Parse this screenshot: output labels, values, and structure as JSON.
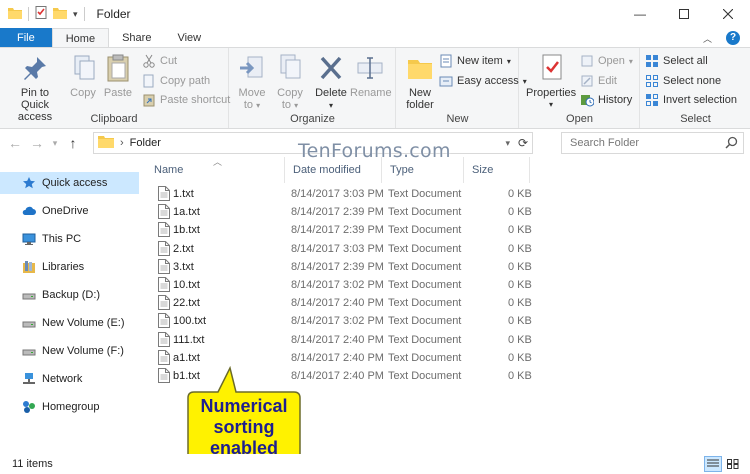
{
  "window": {
    "title": "Folder"
  },
  "tabs": [
    {
      "label": "File"
    },
    {
      "label": "Home"
    },
    {
      "label": "Share"
    },
    {
      "label": "View"
    }
  ],
  "ribbon": {
    "clipboard": {
      "label": "Clipboard",
      "pin": "Pin to Quick access",
      "copy": "Copy",
      "paste": "Paste",
      "cut": "Cut",
      "copy_path": "Copy path",
      "paste_shortcut": "Paste shortcut"
    },
    "organize": {
      "label": "Organize",
      "move_to": "Move to",
      "copy_to": "Copy to",
      "delete": "Delete",
      "rename": "Rename"
    },
    "new": {
      "label": "New",
      "new_folder": "New folder",
      "new_item": "New item",
      "easy_access": "Easy access"
    },
    "open": {
      "label": "Open",
      "properties": "Properties",
      "open": "Open",
      "edit": "Edit",
      "history": "History"
    },
    "select": {
      "label": "Select",
      "select_all": "Select all",
      "select_none": "Select none",
      "invert": "Invert selection"
    }
  },
  "address": {
    "path": "Folder",
    "search_placeholder": "Search Folder"
  },
  "watermark": "TenForums.com",
  "nav_pane": [
    {
      "label": "Quick access",
      "icon": "star-icon"
    },
    {
      "label": "OneDrive",
      "icon": "cloud-icon"
    },
    {
      "label": "This PC",
      "icon": "computer-icon"
    },
    {
      "label": "Libraries",
      "icon": "library-icon"
    },
    {
      "label": "Backup (D:)",
      "icon": "drive-icon"
    },
    {
      "label": "New Volume (E:)",
      "icon": "drive-icon"
    },
    {
      "label": "New Volume (F:)",
      "icon": "drive-icon"
    },
    {
      "label": "Network",
      "icon": "network-icon"
    },
    {
      "label": "Homegroup",
      "icon": "homegroup-icon"
    }
  ],
  "columns": {
    "name": "Name",
    "date": "Date modified",
    "type": "Type",
    "size": "Size"
  },
  "files": [
    {
      "name": "1.txt",
      "date": "8/14/2017 3:03 PM",
      "type": "Text Document",
      "size": "0 KB"
    },
    {
      "name": "1a.txt",
      "date": "8/14/2017 2:39 PM",
      "type": "Text Document",
      "size": "0 KB"
    },
    {
      "name": "1b.txt",
      "date": "8/14/2017 2:39 PM",
      "type": "Text Document",
      "size": "0 KB"
    },
    {
      "name": "2.txt",
      "date": "8/14/2017 3:03 PM",
      "type": "Text Document",
      "size": "0 KB"
    },
    {
      "name": "3.txt",
      "date": "8/14/2017 2:39 PM",
      "type": "Text Document",
      "size": "0 KB"
    },
    {
      "name": "10.txt",
      "date": "8/14/2017 3:02 PM",
      "type": "Text Document",
      "size": "0 KB"
    },
    {
      "name": "22.txt",
      "date": "8/14/2017 2:40 PM",
      "type": "Text Document",
      "size": "0 KB"
    },
    {
      "name": "100.txt",
      "date": "8/14/2017 3:02 PM",
      "type": "Text Document",
      "size": "0 KB"
    },
    {
      "name": "111.txt",
      "date": "8/14/2017 2:40 PM",
      "type": "Text Document",
      "size": "0 KB"
    },
    {
      "name": "a1.txt",
      "date": "8/14/2017 2:40 PM",
      "type": "Text Document",
      "size": "0 KB"
    },
    {
      "name": "b1.txt",
      "date": "8/14/2017 2:40 PM",
      "type": "Text Document",
      "size": "0 KB"
    }
  ],
  "callout": {
    "line1": "Numerical",
    "line2": "sorting",
    "line3": "enabled"
  },
  "status": {
    "item_count": "11 items"
  },
  "colors": {
    "accent": "#1979ca",
    "selected": "#cce8ff",
    "callout_fill": "#fff200",
    "callout_text": "#1e1e8f"
  }
}
